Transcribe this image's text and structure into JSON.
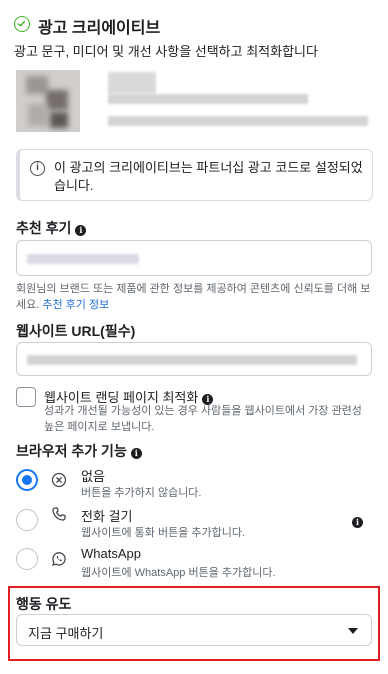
{
  "header": {
    "title": "광고 크리에이티브",
    "subtitle": "광고 문구, 미디어 및 개선 사항을 선택하고 최적화합니다"
  },
  "notice": {
    "text": "이 광고의 크리에이티브는 파트너십 광고 코드로 설정되었습니다."
  },
  "recommendation": {
    "label": "추천 후기",
    "help": "회원님의 브랜드 또는 제품에 관한 정보를 제공하여 콘텐츠에 신뢰도를 더해 보세요.",
    "help_link": "추천 후기 정보"
  },
  "website": {
    "label": "웹사이트 URL(필수)"
  },
  "landing_optimization": {
    "title": "웹사이트 랜딩 페이지 최적화",
    "description": "성과가 개선될 가능성이 있는 경우 사람들을 웹사이트에서 가장 관련성 높은 페이지로 보냅니다.",
    "checked": false
  },
  "browser_addon": {
    "label": "브라우저 추가 기능",
    "options": [
      {
        "title": "없음",
        "subtitle": "버튼을 추가하지 않습니다.",
        "icon": "close-circle-icon",
        "selected": true
      },
      {
        "title": "전화 걸기",
        "subtitle": "웹사이트에 통화 버튼을 추가합니다.",
        "icon": "phone-icon",
        "selected": false
      },
      {
        "title": "WhatsApp",
        "subtitle": "웹사이트에 WhatsApp 버튼을 추가합니다.",
        "icon": "whatsapp-icon",
        "selected": false
      }
    ]
  },
  "call_to_action": {
    "label": "행동 유도",
    "selected": "지금 구매하기"
  },
  "colors": {
    "accent": "#1877f2",
    "success": "#42b72a",
    "link": "#216fdb",
    "highlight_border": "#e02020"
  }
}
